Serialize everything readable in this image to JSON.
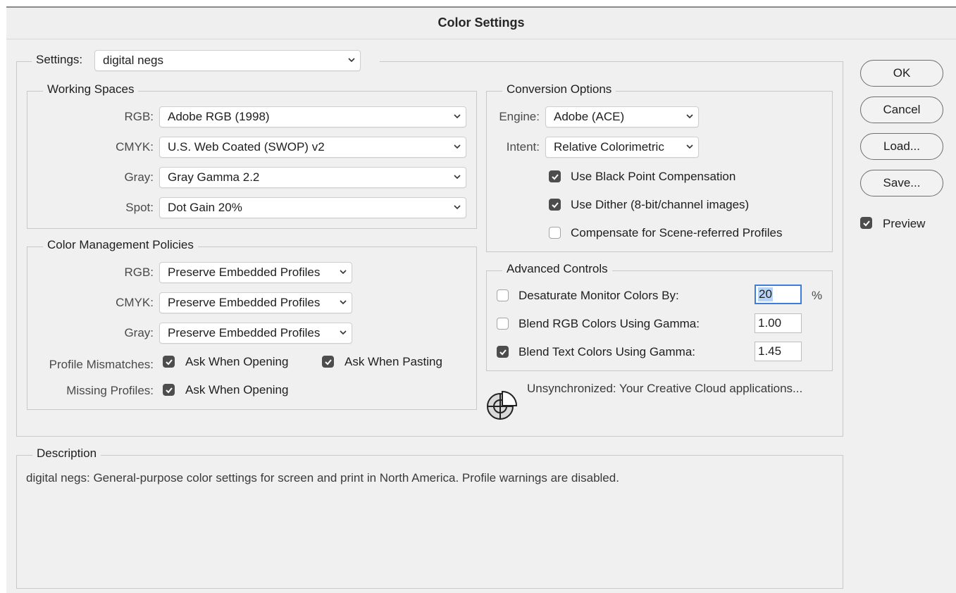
{
  "window": {
    "title": "Color Settings"
  },
  "settings": {
    "label": "Settings:",
    "value": "digital negs"
  },
  "working_spaces": {
    "title": "Working Spaces",
    "rows": [
      {
        "label": "RGB:",
        "value": "Adobe RGB (1998)"
      },
      {
        "label": "CMYK:",
        "value": "U.S. Web Coated (SWOP) v2"
      },
      {
        "label": "Gray:",
        "value": "Gray Gamma 2.2"
      },
      {
        "label": "Spot:",
        "value": "Dot Gain 20%"
      }
    ]
  },
  "policies": {
    "title": "Color Management Policies",
    "rows": [
      {
        "label": "RGB:",
        "value": "Preserve Embedded Profiles"
      },
      {
        "label": "CMYK:",
        "value": "Preserve Embedded Profiles"
      },
      {
        "label": "Gray:",
        "value": "Preserve Embedded Profiles"
      }
    ],
    "mismatches_label": "Profile Mismatches:",
    "ask_opening": {
      "label": "Ask When Opening",
      "checked": true
    },
    "ask_pasting": {
      "label": "Ask When Pasting",
      "checked": true
    },
    "missing_label": "Missing Profiles:",
    "missing_ask_opening": {
      "label": "Ask When Opening",
      "checked": true
    }
  },
  "conversion": {
    "title": "Conversion Options",
    "engine_label": "Engine:",
    "engine_value": "Adobe (ACE)",
    "intent_label": "Intent:",
    "intent_value": "Relative Colorimetric",
    "black_point": {
      "label": "Use Black Point Compensation",
      "checked": true
    },
    "dither": {
      "label": "Use Dither (8-bit/channel images)",
      "checked": true
    },
    "scene_referred": {
      "label": "Compensate for Scene-referred Profiles",
      "checked": false
    }
  },
  "advanced": {
    "title": "Advanced Controls",
    "desaturate": {
      "label": "Desaturate Monitor Colors By:",
      "checked": false,
      "value": "20",
      "unit": "%"
    },
    "blend_rgb": {
      "label": "Blend RGB Colors Using Gamma:",
      "checked": false,
      "value": "1.00"
    },
    "blend_text": {
      "label": "Blend Text Colors Using Gamma:",
      "checked": true,
      "value": "1.45"
    }
  },
  "sync": {
    "icon": "color-sync-icon",
    "text": "Unsynchronized: Your Creative Cloud applications..."
  },
  "description": {
    "title": "Description",
    "text": "digital negs:  General-purpose color settings for screen and print in North America. Profile warnings are disabled."
  },
  "buttons": {
    "ok": "OK",
    "cancel": "Cancel",
    "load": "Load...",
    "save": "Save..."
  },
  "preview": {
    "label": "Preview",
    "checked": true
  },
  "colors": {
    "focus": "#3f7ddb",
    "checkbox": "#4d4d4d"
  }
}
